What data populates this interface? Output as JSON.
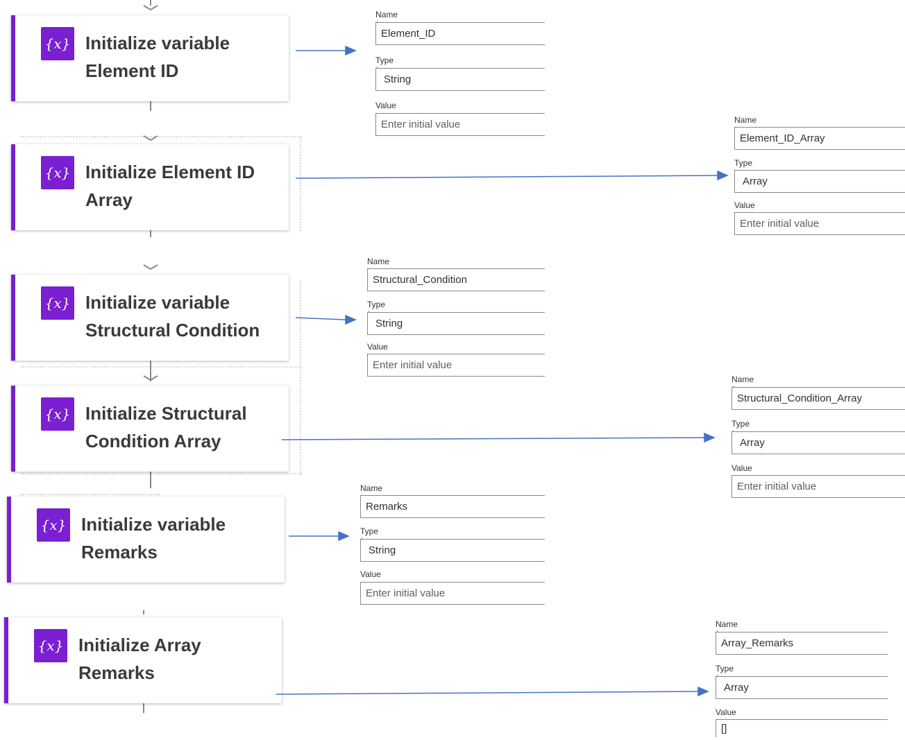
{
  "flow_cards": [
    {
      "icon": "variable-icon",
      "icon_glyph": "{x}",
      "title": "Initialize variable\nElement ID"
    },
    {
      "icon": "variable-icon",
      "icon_glyph": "{x}",
      "title": "Initialize Element ID\nArray"
    },
    {
      "icon": "variable-icon",
      "icon_glyph": "{x}",
      "title": "Initialize variable\nStructural Condition"
    },
    {
      "icon": "variable-icon",
      "icon_glyph": "{x}",
      "title": "Initialize Structural\nCondition Array"
    },
    {
      "icon": "variable-icon",
      "icon_glyph": "{x}",
      "title": "Initialize variable\nRemarks"
    },
    {
      "icon": "variable-icon",
      "icon_glyph": "{x}",
      "title": "Initialize Array\nRemarks"
    }
  ],
  "forms": [
    {
      "name_label": "Name",
      "name_value": "Element_ID",
      "type_label": "Type",
      "type_value": "String",
      "value_label": "Value",
      "value_placeholder": "Enter initial value",
      "value_value": ""
    },
    {
      "name_label": "Name",
      "name_value": "Element_ID_Array",
      "type_label": "Type",
      "type_value": "Array",
      "value_label": "Value",
      "value_placeholder": "Enter initial value",
      "value_value": ""
    },
    {
      "name_label": "Name",
      "name_value": "Structural_Condition",
      "type_label": "Type",
      "type_value": "String",
      "value_label": "Value",
      "value_placeholder": "Enter initial value",
      "value_value": ""
    },
    {
      "name_label": "Name",
      "name_value": "Structural_Condition_Array",
      "type_label": "Type",
      "type_value": "Array",
      "value_label": "Value",
      "value_placeholder": "Enter initial value",
      "value_value": ""
    },
    {
      "name_label": "Name",
      "name_value": "Remarks",
      "type_label": "Type",
      "type_value": "String",
      "value_label": "Value",
      "value_placeholder": "Enter initial value",
      "value_value": ""
    },
    {
      "name_label": "Name",
      "name_value": "Array_Remarks",
      "type_label": "Type",
      "type_value": "Array",
      "value_label": "Value",
      "value_placeholder": "",
      "value_value": "[]"
    }
  ],
  "colors": {
    "accent": "#7a1fd1",
    "arrow": "#4472c4",
    "required": "#c50f1f"
  }
}
